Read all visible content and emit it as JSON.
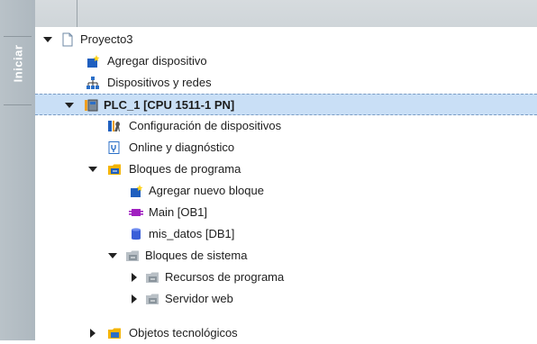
{
  "sidebar": {
    "tab_label": "Iniciar"
  },
  "tree": {
    "items": [
      {
        "label": "Proyecto3",
        "icon": "project-document-icon"
      },
      {
        "label": "Agregar dispositivo",
        "icon": "add-device-icon"
      },
      {
        "label": "Dispositivos y redes",
        "icon": "network-icon"
      },
      {
        "label": "PLC_1 [CPU 1511-1 PN]",
        "icon": "plc-icon",
        "selected": true
      },
      {
        "label": "Configuración de dispositivos",
        "icon": "device-config-icon"
      },
      {
        "label": "Online y diagnóstico",
        "icon": "online-diagnostics-icon"
      },
      {
        "label": "Bloques de programa",
        "icon": "program-blocks-folder-icon"
      },
      {
        "label": "Agregar nuevo bloque",
        "icon": "add-block-icon"
      },
      {
        "label": "Main [OB1]",
        "icon": "ob-block-icon"
      },
      {
        "label": "mis_datos [DB1]",
        "icon": "db-block-icon"
      },
      {
        "label": "Bloques de sistema",
        "icon": "system-blocks-folder-icon"
      },
      {
        "label": "Recursos de programa",
        "icon": "program-resources-folder-icon"
      },
      {
        "label": "Servidor web",
        "icon": "web-server-folder-icon"
      },
      {
        "label": "Objetos tecnológicos",
        "icon": "technology-objects-folder-icon"
      }
    ]
  }
}
